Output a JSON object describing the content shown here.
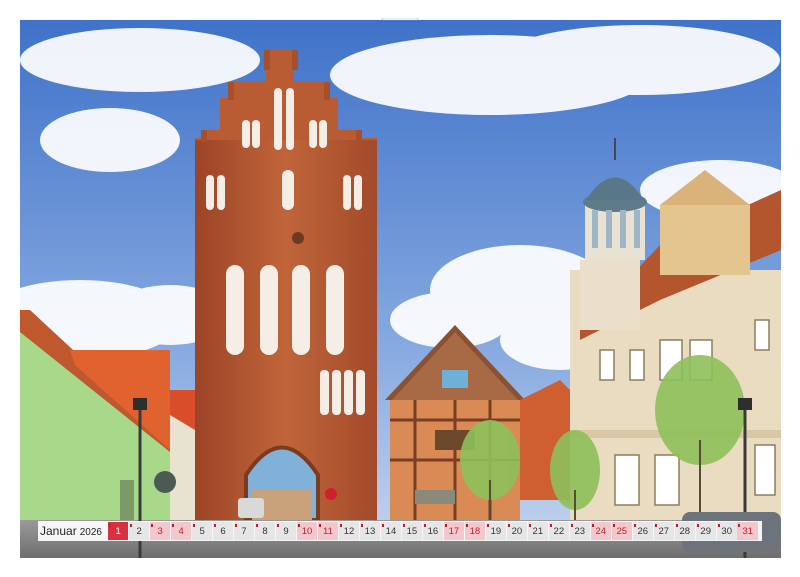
{
  "calendar": {
    "month_name": "Januar",
    "year": "2026",
    "days": [
      "1",
      "2",
      "3",
      "4",
      "5",
      "6",
      "7",
      "8",
      "9",
      "10",
      "11",
      "12",
      "13",
      "14",
      "15",
      "16",
      "17",
      "18",
      "19",
      "20",
      "21",
      "22",
      "23",
      "24",
      "25",
      "26",
      "27",
      "28",
      "29",
      "30",
      "31"
    ],
    "weekend_days": [
      3,
      4,
      10,
      11,
      17,
      18,
      24,
      25,
      31
    ],
    "holiday_days": [
      1
    ],
    "holiday_color": "#d9303e",
    "weekend_color": "#f2c8cc"
  },
  "photo": {
    "subject": "brick city gate tower with half-timbered house and domed building",
    "sky_color": "#5a86d4",
    "brick_color": "#b55a32"
  },
  "binding": {
    "ring_count": 62,
    "hanger": "hanger-notch"
  }
}
